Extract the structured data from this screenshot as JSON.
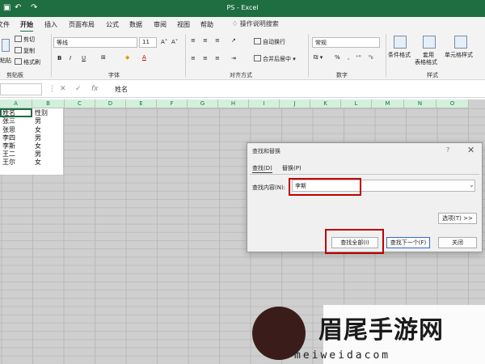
{
  "window": {
    "title": "PS - Excel"
  },
  "tabs": [
    "文件",
    "开始",
    "插入",
    "页面布局",
    "公式",
    "数据",
    "审阅",
    "视图",
    "帮助"
  ],
  "tell_me": "操作说明搜索",
  "ribbon": {
    "cut": "剪切",
    "copy": "复制",
    "format_painter": "格式刷",
    "paste": "粘贴",
    "font_name": "等线",
    "font_size": "11",
    "bold": "B",
    "italic": "I",
    "underline": "U",
    "wrap_text": "自动换行",
    "merge_center": "合并后居中",
    "number_format": "常规",
    "conditional_format": "条件格式",
    "table_format_1": "套用",
    "table_format_2": "表格格式",
    "cell_styles": "单元格样式",
    "groups": {
      "clipboard": "剪贴板",
      "font": "字体",
      "alignment": "对齐方式",
      "number": "数字",
      "styles": "样式"
    }
  },
  "formula_bar": {
    "value": "姓名"
  },
  "sheet": {
    "columns": [
      "A",
      "B",
      "C",
      "D",
      "E",
      "F",
      "G",
      "H",
      "I",
      "J",
      "K",
      "L",
      "M",
      "N",
      "O"
    ],
    "rows": [
      [
        "姓名",
        "性别"
      ],
      [
        "张三",
        "男"
      ],
      [
        "张思",
        "女"
      ],
      [
        "李四",
        "男"
      ],
      [
        "李斯",
        "女"
      ],
      [
        "王二",
        "男"
      ],
      [
        "王尔",
        "女"
      ]
    ]
  },
  "dialog": {
    "title": "查找和替换",
    "help": "?",
    "close": "✕",
    "tab_find": "查找(D)",
    "tab_replace": "替换(P)",
    "find_label": "查找内容(N):",
    "find_value": "李斯",
    "options": "选项(T) >>",
    "find_all": "查找全部(I)",
    "find_next": "查找下一个(F)",
    "close_btn": "关闭"
  },
  "watermark": {
    "text": "眉尾手游网",
    "url": "meiweidacom"
  },
  "colors": {
    "accent": "#1e6e42",
    "highlight": "#c00000"
  }
}
